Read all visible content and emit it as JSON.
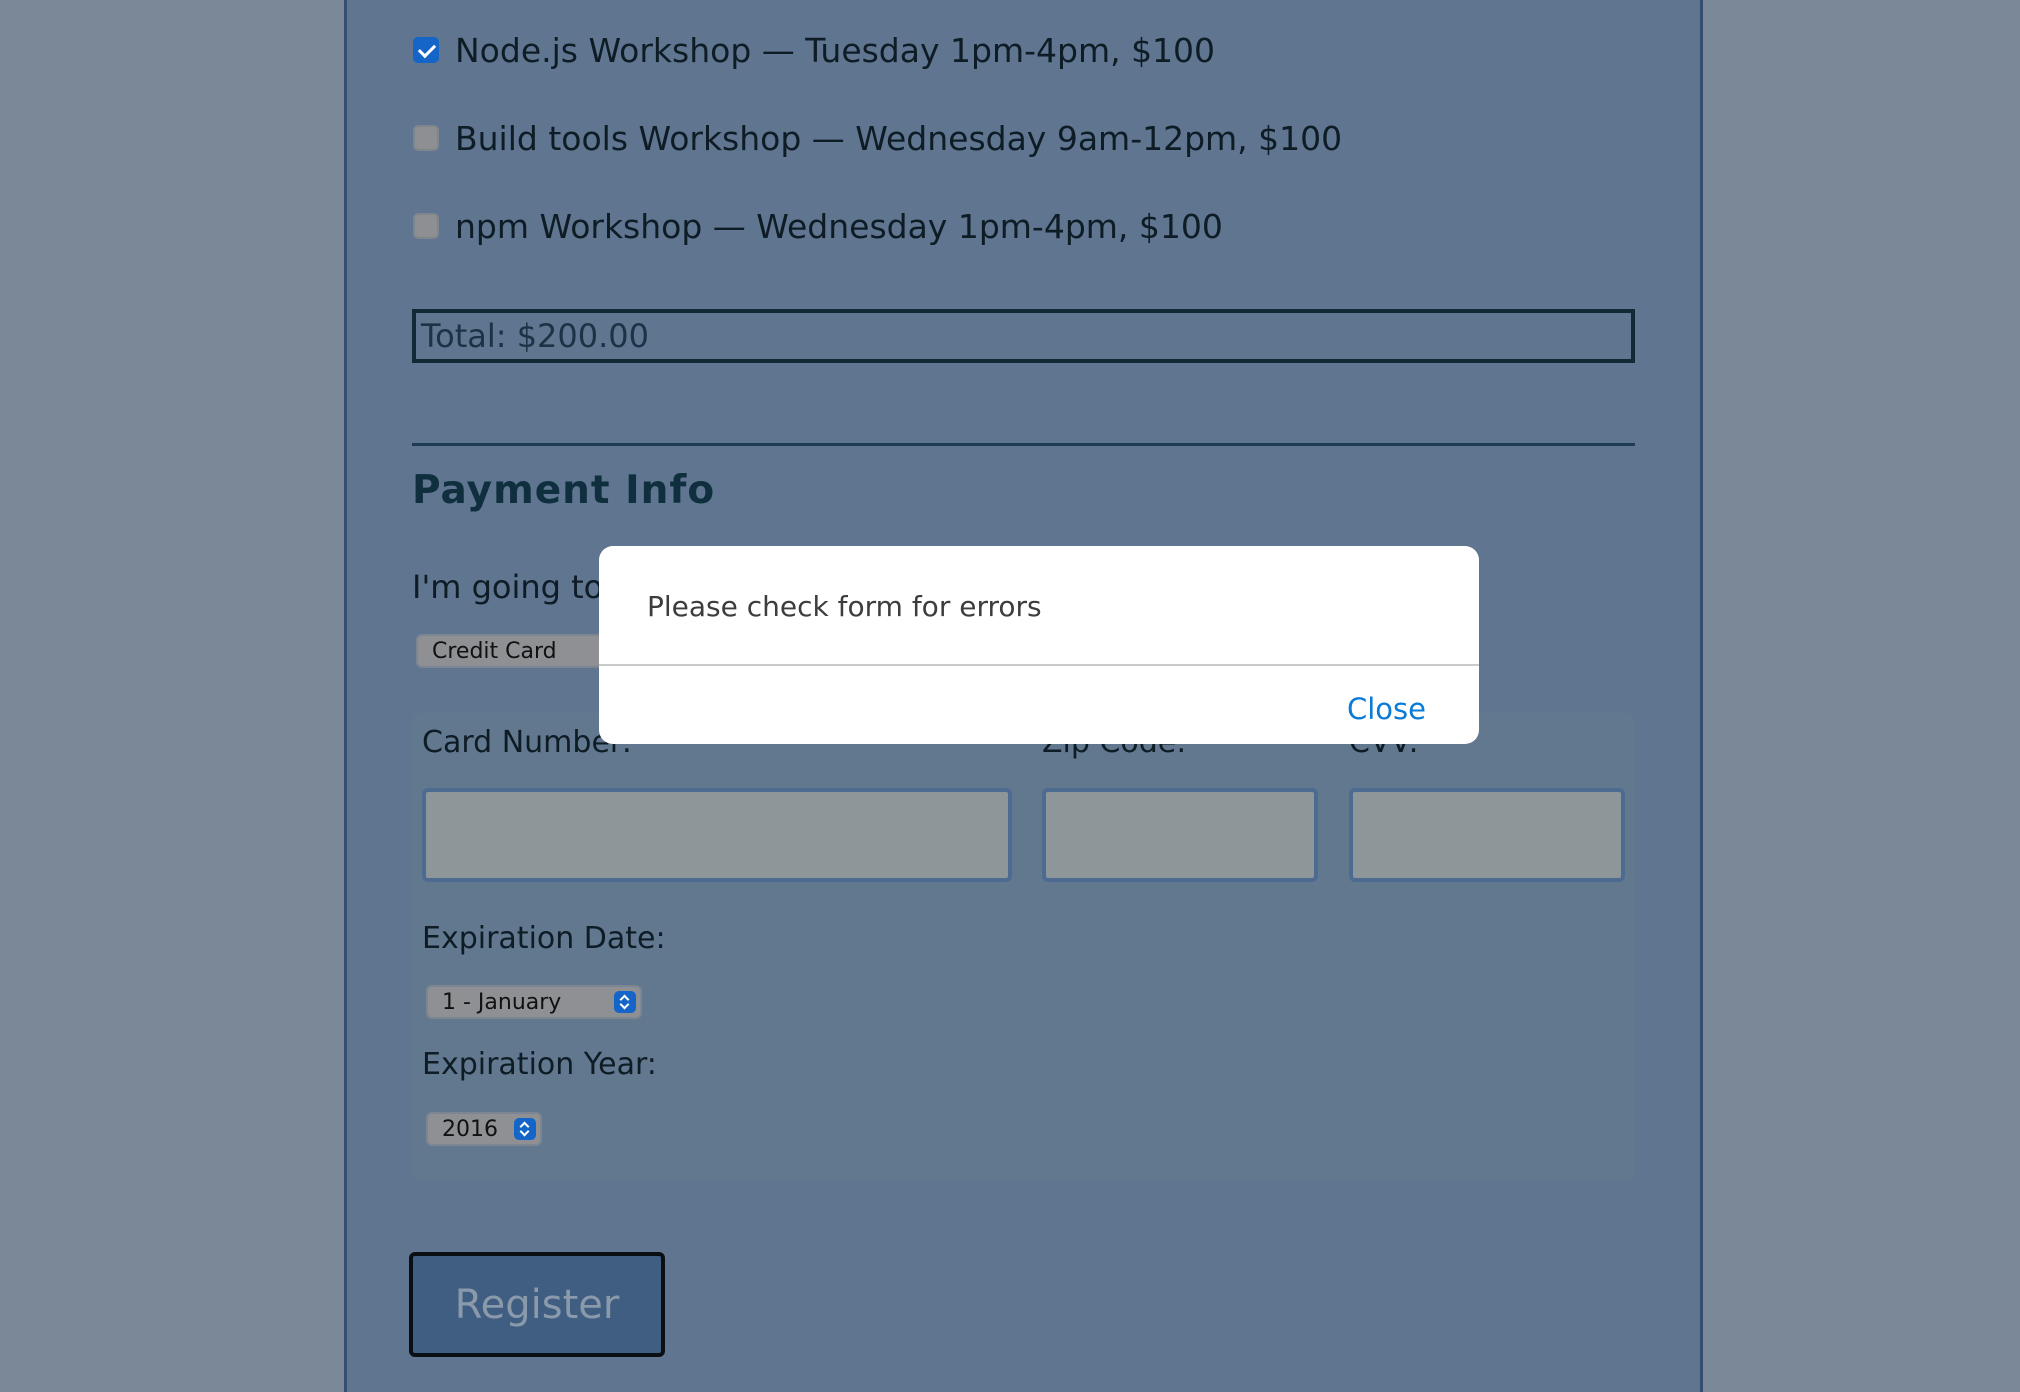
{
  "activities": [
    {
      "label": "Node.js Workshop — Tuesday 1pm-4pm, $100",
      "checked": true
    },
    {
      "label": "Build tools Workshop — Wednesday 9am-12pm, $100",
      "checked": false
    },
    {
      "label": "npm Workshop — Wednesday 1pm-4pm, $100",
      "checked": false
    }
  ],
  "total": "Total: $200.00",
  "payment": {
    "heading": "Payment Info",
    "pay_label": "I'm going to p",
    "method": "Credit Card",
    "card_number_label": "Card Number:",
    "zip_label": "Zip Code:",
    "cvv_label": "CVV:",
    "card_number_value": "",
    "zip_value": "",
    "cvv_value": "",
    "exp_date_label": "Expiration Date:",
    "exp_month": "1 - January",
    "exp_year_label": "Expiration Year:",
    "exp_year": "2016"
  },
  "register_label": "Register",
  "dialog": {
    "message": "Please check form for errors",
    "close_label": "Close"
  },
  "colors": {
    "checkbox_checked": "#1565c9",
    "link": "#0a7bd6"
  }
}
